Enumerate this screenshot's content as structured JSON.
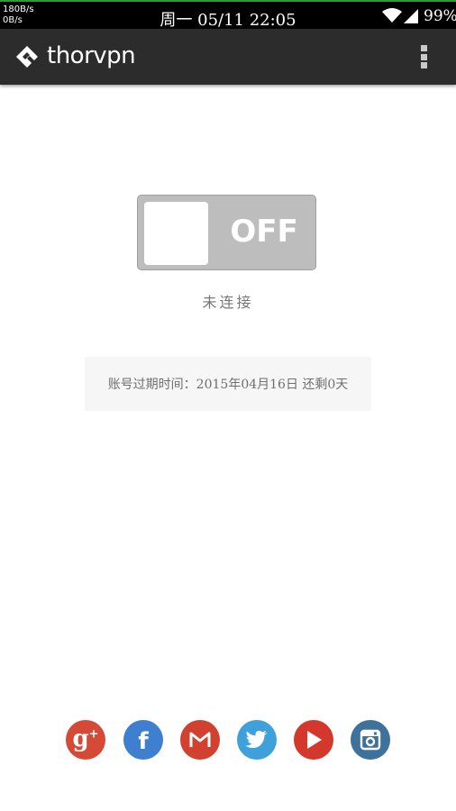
{
  "status_bar": {
    "net_up": "180B/s",
    "net_down": "0B/s",
    "datetime": "周一 05/11 22:05",
    "battery": "99%"
  },
  "action_bar": {
    "title": "thorvpn",
    "logo_icon": "thor-hammer-icon",
    "menu_icon": "overflow-menu-icon"
  },
  "vpn": {
    "toggle_label": "OFF",
    "toggle_state": "off",
    "status": "未连接"
  },
  "account": {
    "expiry_text": "账号过期时间：2015年04月16日 还剩0天"
  },
  "social": [
    {
      "name": "google-plus",
      "icon": "google-plus-icon",
      "color": "#d44a37"
    },
    {
      "name": "facebook",
      "icon": "facebook-icon",
      "color": "#3f7fd0"
    },
    {
      "name": "gmail",
      "icon": "gmail-icon",
      "color": "#d2402f"
    },
    {
      "name": "twitter",
      "icon": "twitter-icon",
      "color": "#3fa1dc"
    },
    {
      "name": "youtube",
      "icon": "youtube-icon",
      "color": "#d4382c"
    },
    {
      "name": "instagram",
      "icon": "instagram-icon",
      "color": "#3f729b"
    }
  ],
  "colors": {
    "action_bar": "#2c2c2c",
    "toggle_off": "#bdbdbd"
  }
}
